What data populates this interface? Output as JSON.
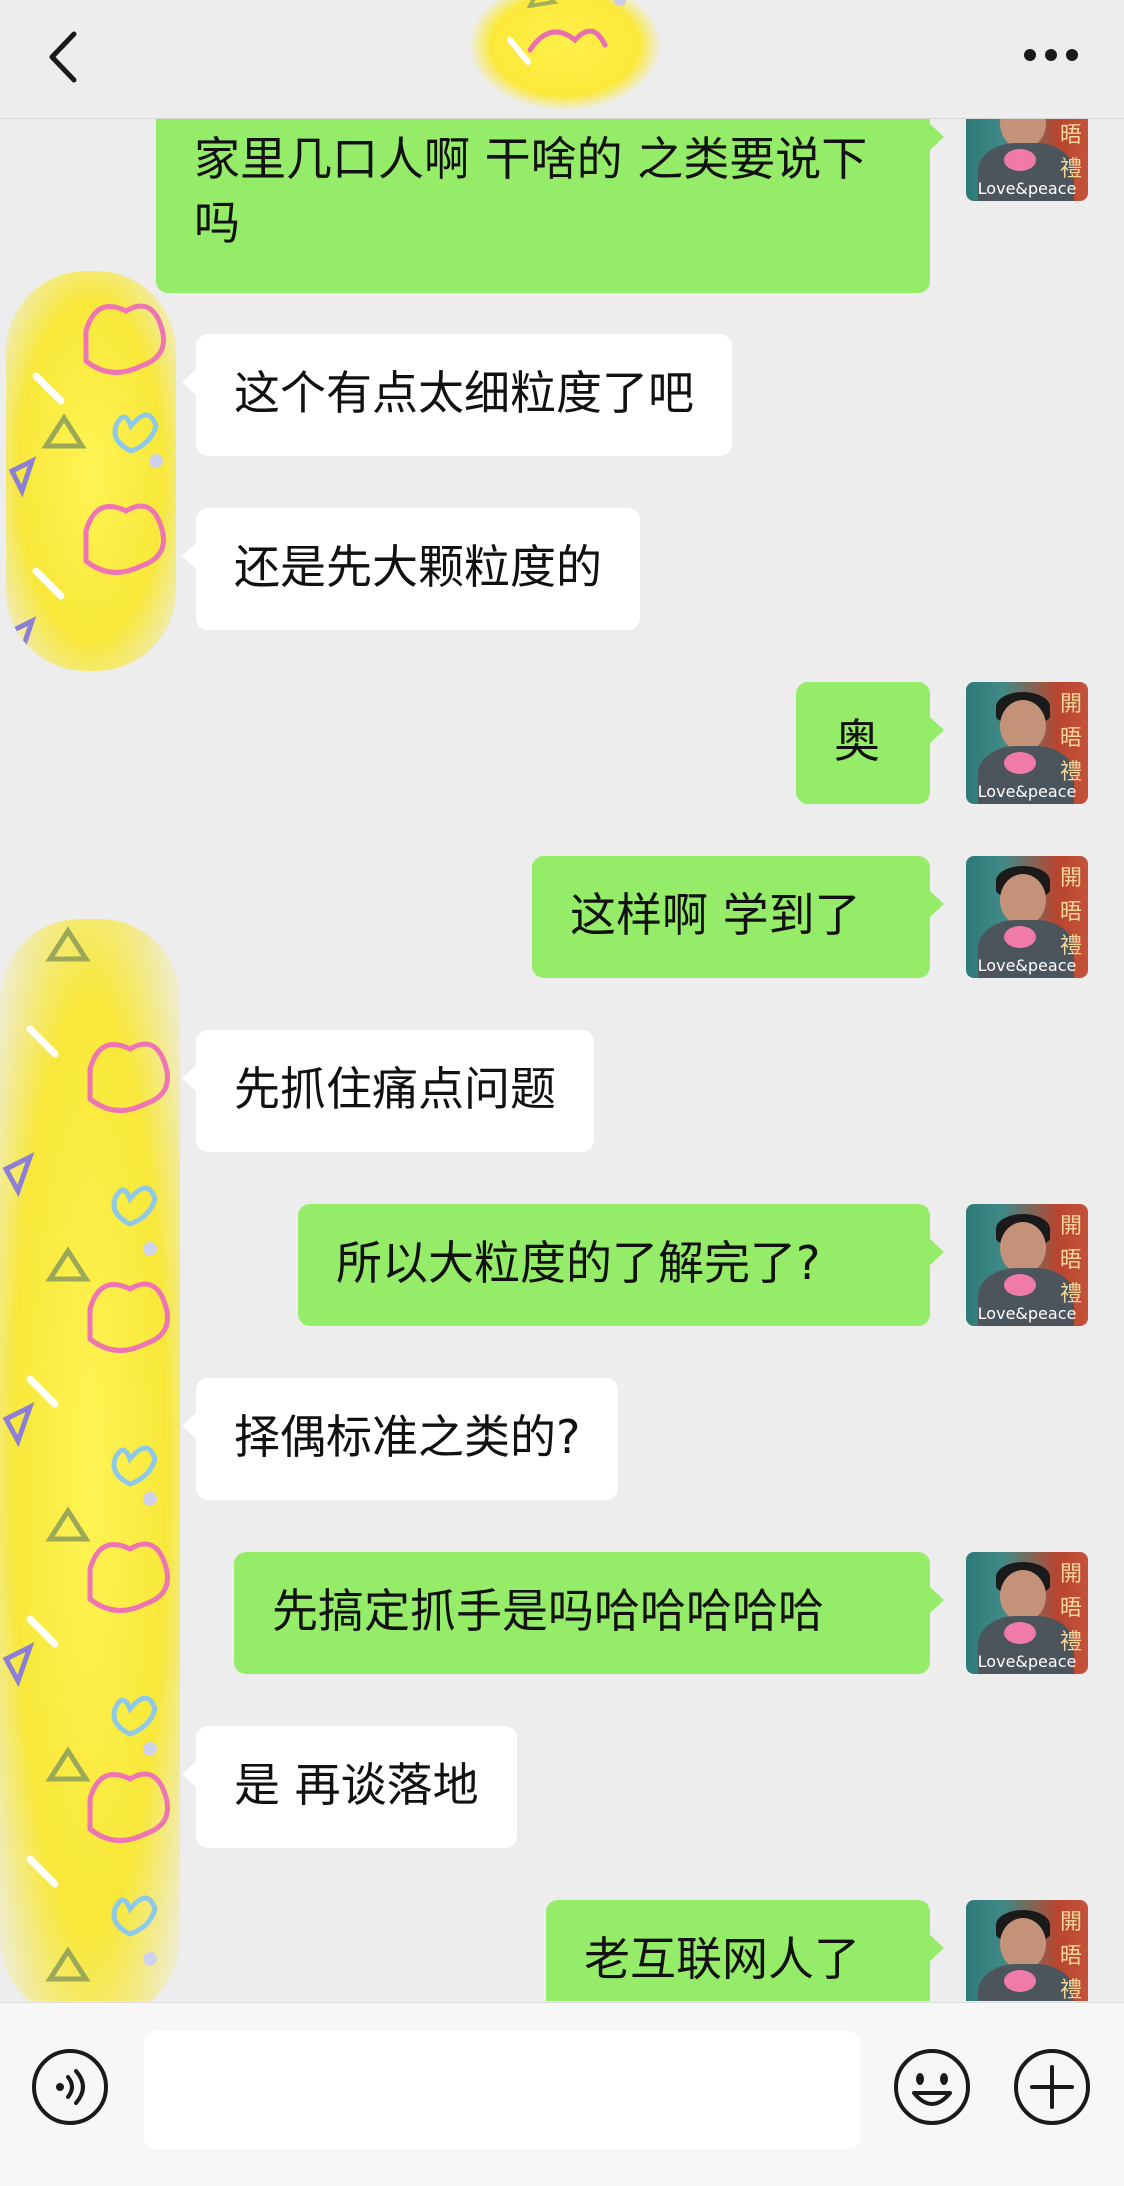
{
  "header": {
    "title": "",
    "back_icon": "chevron-left-icon",
    "more_icon": "more-dots-icon"
  },
  "avatar": {
    "caption": "Love&peace",
    "glyphs": "開 晤 禮"
  },
  "messages": [
    {
      "side": "sent",
      "text": "家里几口人啊 干啥的 之类要说下吗"
    },
    {
      "side": "recv",
      "text": "这个有点太细粒度了吧"
    },
    {
      "side": "recv",
      "text": "还是先大颗粒度的"
    },
    {
      "side": "sent",
      "text": "奥"
    },
    {
      "side": "sent",
      "text": "这样啊 学到了"
    },
    {
      "side": "recv",
      "text": "先抓住痛点问题"
    },
    {
      "side": "sent",
      "text": "所以大粒度的了解完了?"
    },
    {
      "side": "recv",
      "text": "择偶标准之类的?"
    },
    {
      "side": "sent",
      "text": "先搞定抓手是吗哈哈哈哈哈"
    },
    {
      "side": "recv",
      "text": "是 再谈落地"
    },
    {
      "side": "sent",
      "text": "老互联网人了"
    }
  ],
  "input": {
    "value": "",
    "placeholder": ""
  },
  "toolbar": {
    "voice_icon": "voice-icon",
    "emoji_icon": "emoji-icon",
    "plus_icon": "plus-icon"
  },
  "colors": {
    "sent_bubble": "#95ec69",
    "recv_bubble": "#ffffff",
    "background": "#ededed",
    "sticker_yellow": "#f8e83a"
  }
}
